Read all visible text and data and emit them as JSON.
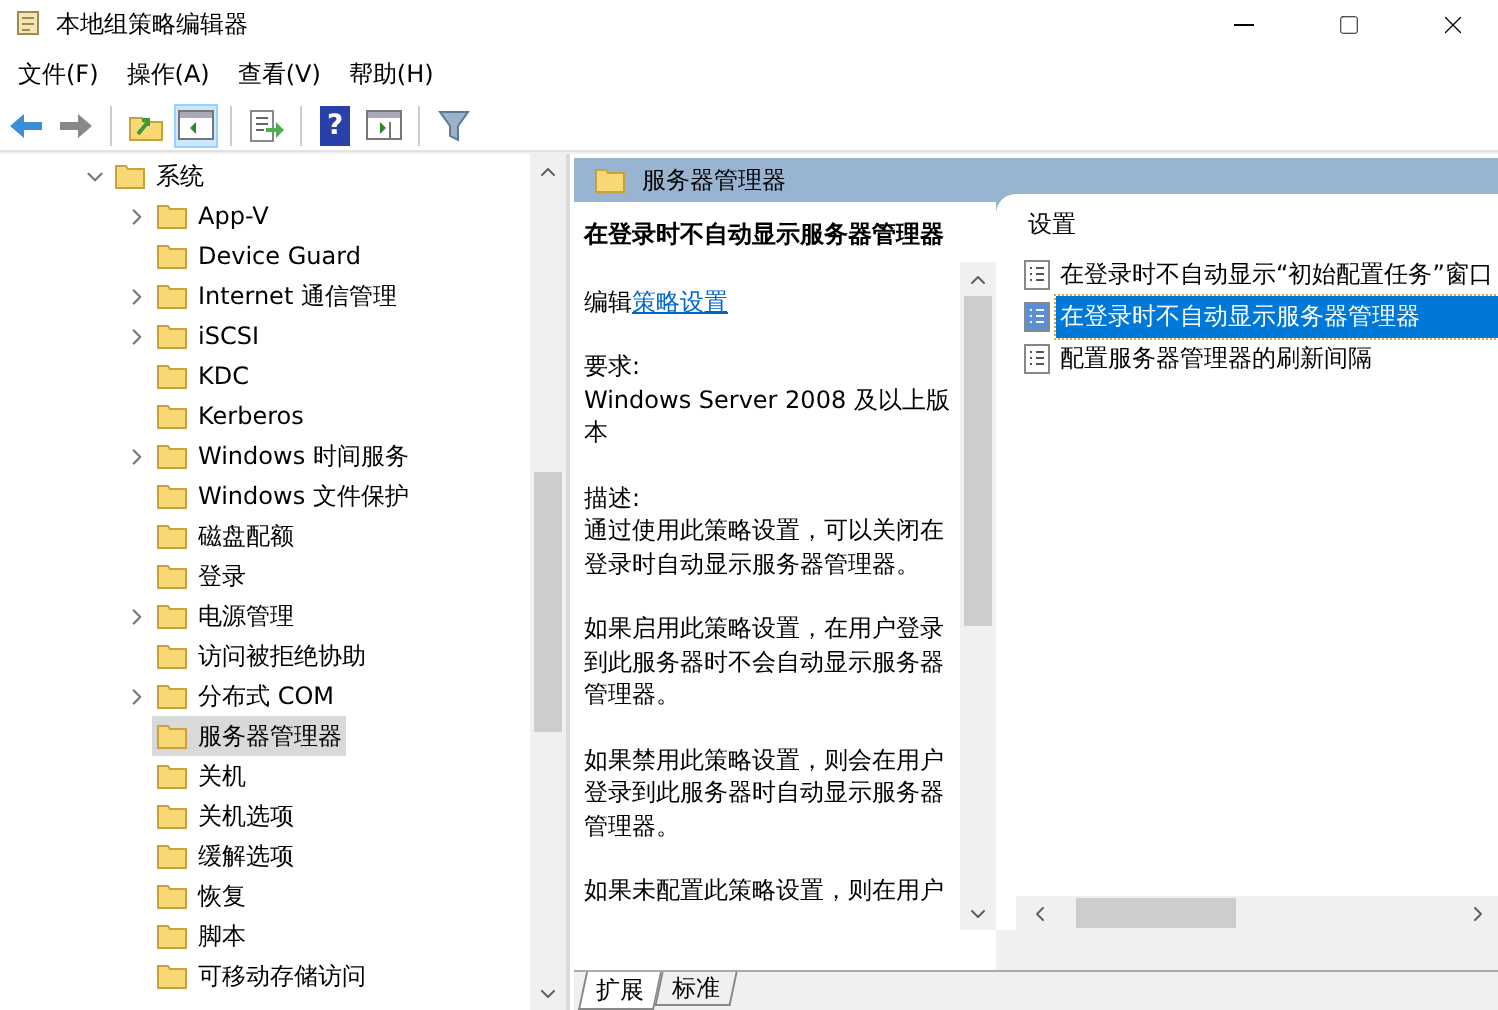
{
  "window": {
    "title": "本地组策略编辑器"
  },
  "menu": [
    "文件(F)",
    "操作(A)",
    "查看(V)",
    "帮助(H)"
  ],
  "toolbar": [
    {
      "kind": "back",
      "pressed": false
    },
    {
      "kind": "forward",
      "pressed": false
    },
    {
      "kind": "sep"
    },
    {
      "kind": "up",
      "pressed": false
    },
    {
      "kind": "tree",
      "pressed": true
    },
    {
      "kind": "sep"
    },
    {
      "kind": "export",
      "pressed": false
    },
    {
      "kind": "sep"
    },
    {
      "kind": "help",
      "pressed": false,
      "label": "?"
    },
    {
      "kind": "pane",
      "pressed": false
    },
    {
      "kind": "sep"
    },
    {
      "kind": "filter",
      "pressed": false
    }
  ],
  "tree": [
    {
      "label": "系统",
      "has_children": true,
      "expanded": true,
      "selected": false,
      "children": [
        {
          "label": "App-V",
          "has_children": true,
          "expanded": false,
          "selected": false
        },
        {
          "label": "Device Guard",
          "has_children": false,
          "selected": false
        },
        {
          "label": "Internet 通信管理",
          "has_children": true,
          "expanded": false,
          "selected": false
        },
        {
          "label": "iSCSI",
          "has_children": true,
          "expanded": false,
          "selected": false
        },
        {
          "label": "KDC",
          "has_children": false,
          "selected": false
        },
        {
          "label": "Kerberos",
          "has_children": false,
          "selected": false
        },
        {
          "label": "Windows 时间服务",
          "has_children": true,
          "expanded": false,
          "selected": false
        },
        {
          "label": "Windows 文件保护",
          "has_children": false,
          "selected": false
        },
        {
          "label": "磁盘配额",
          "has_children": false,
          "selected": false
        },
        {
          "label": "登录",
          "has_children": false,
          "selected": false
        },
        {
          "label": "电源管理",
          "has_children": true,
          "expanded": false,
          "selected": false
        },
        {
          "label": "访问被拒绝协助",
          "has_children": false,
          "selected": false
        },
        {
          "label": "分布式 COM",
          "has_children": true,
          "expanded": false,
          "selected": false
        },
        {
          "label": "服务器管理器",
          "has_children": false,
          "selected": true
        },
        {
          "label": "关机",
          "has_children": false,
          "selected": false
        },
        {
          "label": "关机选项",
          "has_children": false,
          "selected": false
        },
        {
          "label": "缓解选项",
          "has_children": false,
          "selected": false
        },
        {
          "label": "恢复",
          "has_children": false,
          "selected": false
        },
        {
          "label": "脚本",
          "has_children": false,
          "selected": false
        },
        {
          "label": "可移动存储访问",
          "has_children": false,
          "selected": false
        }
      ]
    }
  ],
  "pane_header": "服务器管理器",
  "description": {
    "title": "在登录时不自动显示服务器管理器",
    "edit_prefix": "编辑",
    "edit_link": "策略设置",
    "paragraphs": [
      [
        "要求:",
        "Windows Server 2008 及以上版",
        "本"
      ],
      [
        "描述:",
        "通过使用此策略设置，可以关闭在",
        "登录时自动显示服务器管理器。"
      ],
      [
        "如果启用此策略设置，在用户登录",
        "到此服务器时不会自动显示服务器",
        "管理器。"
      ],
      [
        "如果禁用此策略设置，则会在用户",
        "登录到此服务器时自动显示服务器",
        "管理器。"
      ],
      [
        "如果未配置此策略设置，则在用户"
      ]
    ]
  },
  "settings": {
    "column": "设置",
    "items": [
      {
        "label": "在登录时不自动显示“初始配置任务”窗口",
        "selected": false
      },
      {
        "label": "在登录时不自动显示服务器管理器",
        "selected": true
      },
      {
        "label": "配置服务器管理器的刷新间隔",
        "selected": false
      }
    ]
  },
  "tabs": [
    {
      "label": "扩展",
      "selected": true
    },
    {
      "label": "标准",
      "selected": false
    }
  ]
}
